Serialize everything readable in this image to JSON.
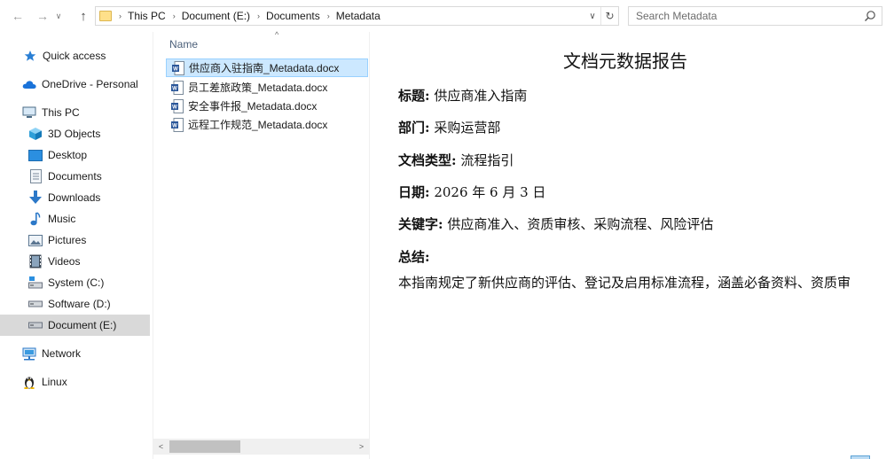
{
  "nav": {
    "back": "←",
    "forward": "→",
    "history": "∨",
    "up": "↑"
  },
  "address": {
    "crumbs": [
      "This PC",
      "Document (E:)",
      "Documents",
      "Metadata"
    ],
    "separator": "›",
    "dropdown": "∨",
    "refresh": "↻"
  },
  "search": {
    "placeholder": "Search Metadata"
  },
  "sidebar": {
    "items": [
      {
        "label": "Quick access",
        "icon": "star-icon"
      },
      {
        "label": "OneDrive - Personal",
        "icon": "cloud-icon"
      },
      {
        "label": "This PC",
        "icon": "computer-icon"
      },
      {
        "label": "3D Objects",
        "icon": "cube-icon"
      },
      {
        "label": "Desktop",
        "icon": "desktop-icon"
      },
      {
        "label": "Documents",
        "icon": "document-icon"
      },
      {
        "label": "Downloads",
        "icon": "download-icon"
      },
      {
        "label": "Music",
        "icon": "music-icon"
      },
      {
        "label": "Pictures",
        "icon": "pictures-icon"
      },
      {
        "label": "Videos",
        "icon": "video-icon"
      },
      {
        "label": "System (C:)",
        "icon": "drive-icon"
      },
      {
        "label": "Software (D:)",
        "icon": "drive-icon"
      },
      {
        "label": "Document (E:)",
        "icon": "drive-icon",
        "selected": true
      },
      {
        "label": "Network",
        "icon": "network-icon"
      },
      {
        "label": "Linux",
        "icon": "linux-icon"
      }
    ]
  },
  "filelist": {
    "column_name": "Name",
    "sort_indicator": "^",
    "files": [
      {
        "name": "供应商入驻指南_Metadata.docx",
        "selected": true
      },
      {
        "name": "员工差旅政策_Metadata.docx"
      },
      {
        "name": "安全事件报_Metadata.docx"
      },
      {
        "name": "远程工作规范_Metadata.docx"
      }
    ],
    "scroll_left": "<",
    "scroll_right": ">"
  },
  "preview": {
    "title": "文档元数据报告",
    "fields": [
      {
        "label": "标题:",
        "value": " 供应商准入指南"
      },
      {
        "label": "部门:",
        "value": " 采购运营部"
      },
      {
        "label": "文档类型:",
        "value": " 流程指引"
      },
      {
        "label": "日期:",
        "value": " 2026 年 6 月 3 日"
      },
      {
        "label": "关键字:",
        "value": " 供应商准入、资质审核、采购流程、风险评估"
      },
      {
        "label": "总结:",
        "value": ""
      }
    ],
    "summary": "本指南规定了新供应商的评估、登记及启用标准流程，涵盖必备资料、资质审"
  },
  "colors": {
    "selection_bg": "#cce8ff",
    "selection_border": "#99d1ff",
    "nav_selected": "#d9d9d9",
    "word_blue": "#2b579a"
  }
}
